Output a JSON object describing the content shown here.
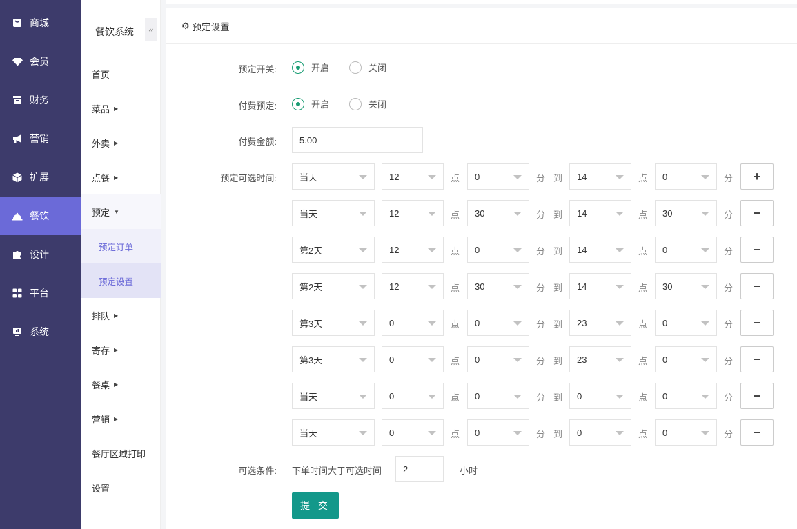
{
  "main_nav": [
    {
      "label": "商城",
      "icon": "shop-icon",
      "active": false
    },
    {
      "label": "会员",
      "icon": "diamond-icon",
      "active": false
    },
    {
      "label": "财务",
      "icon": "wallet-icon",
      "active": false
    },
    {
      "label": "营销",
      "icon": "megaphone-icon",
      "active": false
    },
    {
      "label": "扩展",
      "icon": "cube-icon",
      "active": false
    },
    {
      "label": "餐饮",
      "icon": "cloche-icon",
      "active": true
    },
    {
      "label": "设计",
      "icon": "puzzle-icon",
      "active": false
    },
    {
      "label": "平台",
      "icon": "grid-icon",
      "active": false
    },
    {
      "label": "系统",
      "icon": "monitor-icon",
      "active": false
    }
  ],
  "sub_nav": {
    "title": "餐饮系统",
    "collapse_icon": "«",
    "items": [
      {
        "label": "首页"
      },
      {
        "label": "菜品"
      },
      {
        "label": "外卖"
      },
      {
        "label": "点餐"
      },
      {
        "label": "预定"
      },
      {
        "label": "预定订单"
      },
      {
        "label": "预定设置"
      },
      {
        "label": "排队"
      },
      {
        "label": "寄存"
      },
      {
        "label": "餐桌"
      },
      {
        "label": "营销"
      },
      {
        "label": "餐厅区域打印"
      },
      {
        "label": "设置"
      }
    ]
  },
  "panel": {
    "title": "预定设置",
    "booking_switch": {
      "label": "预定开关:",
      "on": "开启",
      "off": "关闭",
      "value": "开启"
    },
    "paid_booking": {
      "label": "付费预定:",
      "on": "开启",
      "off": "关闭",
      "value": "开启"
    },
    "fee": {
      "label": "付费金额:",
      "value": "5.00"
    },
    "time_label": "预定可选时间:",
    "units": {
      "hour": "点",
      "minute": "分",
      "to": "到"
    },
    "time_rows": [
      {
        "day": "当天",
        "h1": "12",
        "m1": "0",
        "h2": "14",
        "m2": "0",
        "action": "+"
      },
      {
        "day": "当天",
        "h1": "12",
        "m1": "30",
        "h2": "14",
        "m2": "30",
        "action": "−"
      },
      {
        "day": "第2天",
        "h1": "12",
        "m1": "0",
        "h2": "14",
        "m2": "0",
        "action": "−"
      },
      {
        "day": "第2天",
        "h1": "12",
        "m1": "30",
        "h2": "14",
        "m2": "30",
        "action": "−"
      },
      {
        "day": "第3天",
        "h1": "0",
        "m1": "0",
        "h2": "23",
        "m2": "0",
        "action": "−"
      },
      {
        "day": "第3天",
        "h1": "0",
        "m1": "0",
        "h2": "23",
        "m2": "0",
        "action": "−"
      },
      {
        "day": "当天",
        "h1": "0",
        "m1": "0",
        "h2": "0",
        "m2": "0",
        "action": "−"
      },
      {
        "day": "当天",
        "h1": "0",
        "m1": "0",
        "h2": "0",
        "m2": "0",
        "action": "−"
      }
    ],
    "condition": {
      "label": "可选条件:",
      "prefix": "下单时间大于可选时间",
      "value": "2",
      "suffix": "小时"
    },
    "submit": "提 交"
  },
  "colors": {
    "nav_bg": "#3d3b6b",
    "nav_active": "#6b6ad8",
    "accent_green": "#1a9d74",
    "submit": "#13988a"
  }
}
